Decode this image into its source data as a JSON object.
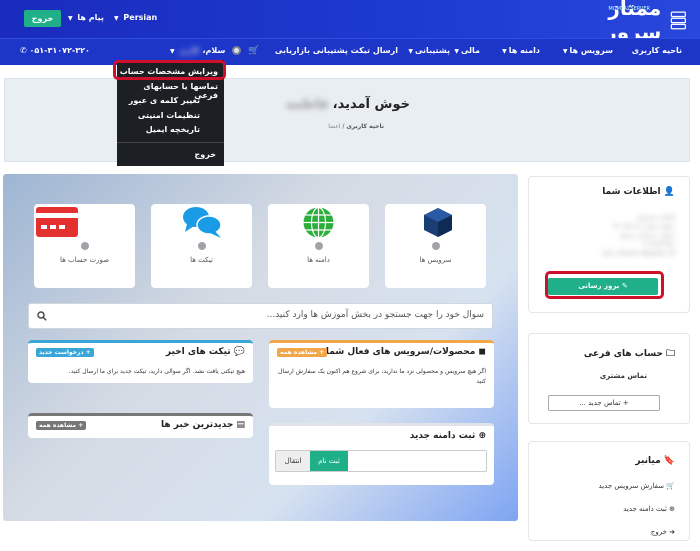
{
  "header": {
    "logo_text": "ممتاز سرور",
    "logo_sub": "MOMTAZSERVER",
    "exit_label": "خروج",
    "messages_label": "پیام ها",
    "language_label": "Persian",
    "phone": "۰۵۱-۳۱۰۷۲-۳۲۰"
  },
  "nav": {
    "items": [
      "ناحیه کاربری",
      "سرویس ها",
      "دامنه ها",
      "مالی",
      "پشتیبانی",
      "ارسال تیکت پشتیبانی",
      "بازاریابی"
    ],
    "greeting": "سلام،",
    "user_name": "کاربر"
  },
  "dropdown": {
    "items": [
      "ویرایش مشخصات حساب",
      "تماسها یا حسابهای فرعی",
      "تغییر کلمه ی عبور",
      "تنظیمات امنیتی",
      "تاریخچه ایمیل"
    ],
    "logout": "خروج"
  },
  "hero": {
    "title": "خوش آمدید،",
    "user_name": "فاطمه",
    "crumb_home": "ناحیه کاربری",
    "crumb_prev": "اعضا"
  },
  "tiles": [
    {
      "label": "سرویس ها",
      "icon": "box-icon"
    },
    {
      "label": "دامنه ها",
      "icon": "globe-icon"
    },
    {
      "label": "تیکت ها",
      "icon": "chat-icon"
    },
    {
      "label": "صورت حساب ها",
      "icon": "card-icon"
    }
  ],
  "search": {
    "placeholder": "سوال خود را جهت جستجو در بخش آموزش ها وارد کنید..."
  },
  "panels": {
    "services": {
      "title": "محصولات/سرویس های فعال شما",
      "badge": "+ مشاهده همه",
      "text": "اگر هیچ سرویس و محصولی نزد ما ندارید، برای شروع هم اکنون یک سفارش ارسال کنید"
    },
    "tickets": {
      "title": "تیکت های اخیر",
      "badge": "+ درخواست جدید",
      "text": "هیچ تیکتی یافت نشد. اگر سوالی دارید، تیکت جدید برای ما ارسال کنید."
    },
    "domain": {
      "title": "ثبت دامنه جدید",
      "register": "ثبت نام",
      "transfer": "انتقال"
    },
    "news": {
      "title": "جدیدترین خبر ها",
      "badge": "+ مشاهده همه"
    }
  },
  "sidebar": {
    "info": {
      "title": "اطلاعات شما",
      "lines": [
        "فاطمه حسینیان",
        "مشهد خیابان احمدآباد ۳۴",
        "مشهد، خراسان رضوی",
        "۹۱۸۳۷۴۲۶۵۱",
        "Iran, Islamic Republic Of"
      ],
      "update_button": "بروز رسانی"
    },
    "contacts": {
      "title": "حساب های فرعی",
      "subtitle": "تماس مشتری",
      "new_button": "+ تماس جدید ..."
    },
    "shortcuts": {
      "title": "میانبر",
      "items": [
        "سفارش سرویس جدید",
        "ثبت دامنه جدید",
        "خروج"
      ]
    }
  },
  "colors": {
    "header_blue": "#1d36c8",
    "green": "#1fb08a",
    "highlight_red": "#d0102a",
    "badge_blue": "#3aa6d8",
    "badge_orange": "#f2a64a",
    "badge_gray": "#777777"
  }
}
